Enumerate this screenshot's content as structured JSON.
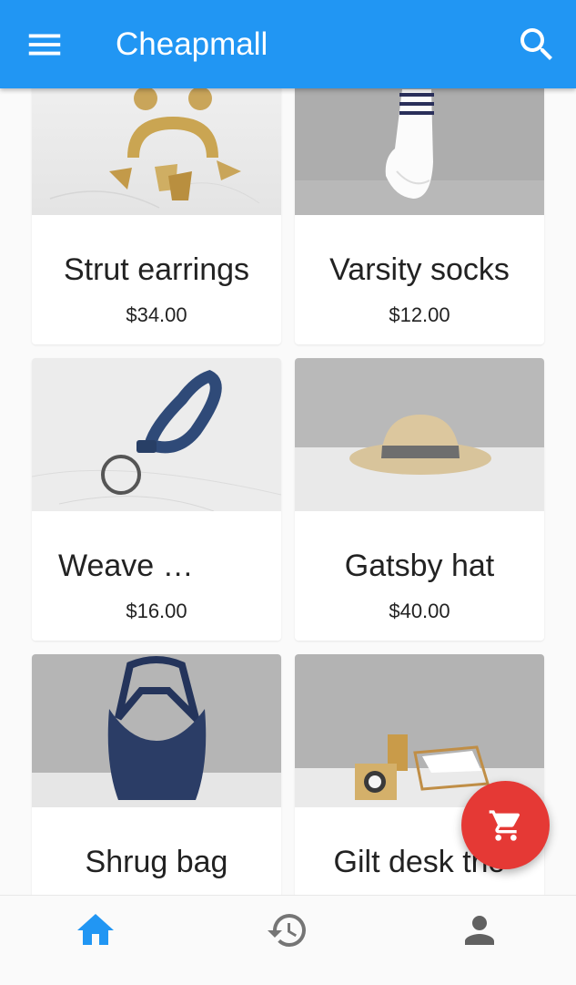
{
  "app": {
    "title": "Cheapmall",
    "accent_color": "#2196F3",
    "fab_color": "#E53935",
    "menu_icon": "menu-icon",
    "search_icon": "search-icon"
  },
  "products": [
    {
      "name": "Strut earrings",
      "price": "$34.00"
    },
    {
      "name": "Varsity socks",
      "price": "$12.00"
    },
    {
      "name": "Weave …",
      "price": "$16.00"
    },
    {
      "name": "Gatsby hat",
      "price": "$40.00"
    },
    {
      "name": "Shrug bag",
      "price": ""
    },
    {
      "name": "Gilt desk trio",
      "price": ""
    }
  ],
  "fab": {
    "icon": "shopping-cart-icon"
  },
  "bottom_nav": [
    {
      "icon": "home-icon",
      "selected": true
    },
    {
      "icon": "history-icon",
      "selected": false
    },
    {
      "icon": "account-icon",
      "selected": false
    }
  ]
}
